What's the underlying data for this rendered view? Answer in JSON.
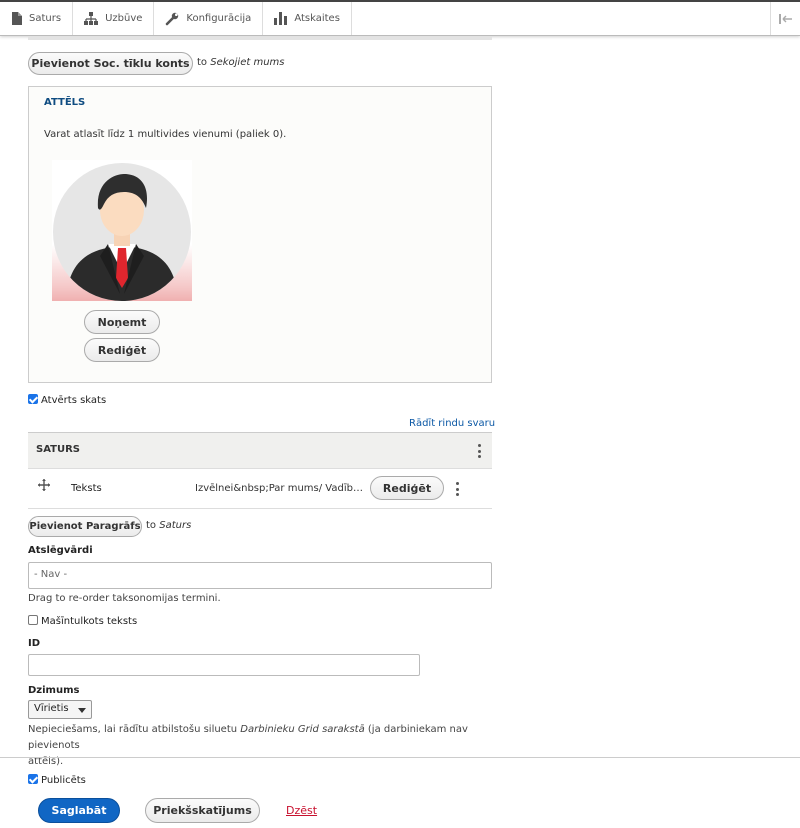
{
  "toolbar": {
    "items": [
      {
        "label": "Saturs",
        "icon": "file-icon"
      },
      {
        "label": "Uzbūve",
        "icon": "sitemap-icon"
      },
      {
        "label": "Konfigurācija",
        "icon": "wrench-icon"
      },
      {
        "label": "Atskaites",
        "icon": "bar-chart-icon"
      }
    ]
  },
  "social": {
    "button_label": "Pievienot Soc. tīklu konts",
    "to_prefix": "to",
    "to_target": "Sekojiet mums"
  },
  "media": {
    "legend": "ATTĒLS",
    "description": "Varat atlasīt līdz 1 multivides vienumi (paliek 0).",
    "remove_label": "Noņemt",
    "edit_label": "Rediģēt"
  },
  "open_view": {
    "label": "Atvērts skats",
    "checked": true
  },
  "show_weights_label": "Rādīt rindu svaru",
  "paragraphs": {
    "header": "SATURS",
    "rows": [
      {
        "type": "Teksts",
        "summary": "Izvēlnei&nbsp;Par mums/ Vadīb…",
        "edit_label": "Rediģēt"
      }
    ],
    "add_button_label": "Pievienot Paragrāfs",
    "to_prefix": "to",
    "to_target": "Saturs"
  },
  "keywords": {
    "label": "Atslēgvārdi",
    "value": "- Nav -",
    "help": "Drag to re-order taksonomijas termini."
  },
  "machine_translated": {
    "label": "Mašīntulkots teksts",
    "checked": false
  },
  "id_field": {
    "label": "ID",
    "value": ""
  },
  "gender": {
    "label": "Dzimums",
    "selected": "Vīrietis",
    "help_line1_prefix": "Nepieciešams, lai rādītu atbilstošu siluetu ",
    "help_line1_italic": "Darbinieku Grid sarakstā",
    "help_line1_suffix": " (ja darbiniekam nav pievienots",
    "help_line2": "attēls)."
  },
  "published": {
    "label": "Publicēts",
    "checked": true
  },
  "actions": {
    "save_label": "Saglabāt",
    "preview_label": "Priekšskatījums",
    "delete_label": "Dzēst"
  },
  "colors": {
    "primary": "#1066c4",
    "danger": "#c8102e",
    "legend": "#0f4c81",
    "tie": "#e0262e"
  }
}
